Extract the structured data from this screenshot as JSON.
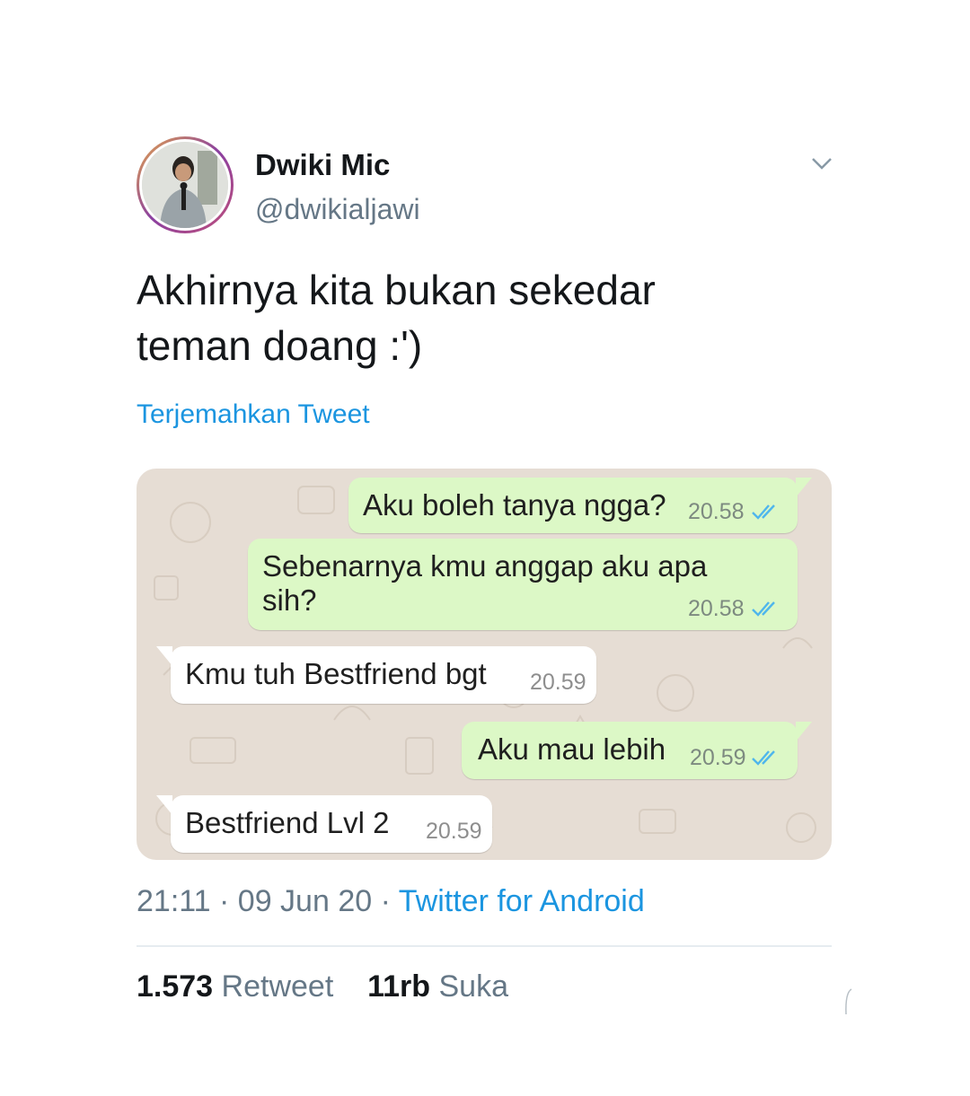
{
  "tweet": {
    "author_name": "Dwiki Mic",
    "author_handle": "@dwikialjawi",
    "text_line1": "Akhirnya kita bukan sekedar",
    "text_line2": "teman doang :')",
    "translate_label": "Terjemahkan Tweet",
    "time": "21:11",
    "date": "09 Jun 20",
    "source": "Twitter for Android",
    "retweet_count": "1.573",
    "retweet_label": "Retweet",
    "like_count": "11rb",
    "like_label": "Suka",
    "menu_icon": "chevron-down-icon"
  },
  "chat": {
    "messages": [
      {
        "direction": "out",
        "line1": "Aku boleh tanya ngga?",
        "time": "20.58",
        "status_icon": "double-check-icon"
      },
      {
        "direction": "out",
        "line1": "Sebenarnya kmu anggap aku apa",
        "line2": "sih?",
        "time": "20.58",
        "status_icon": "double-check-icon"
      },
      {
        "direction": "in",
        "line1": "Kmu tuh Bestfriend bgt",
        "time": "20.59"
      },
      {
        "direction": "out",
        "line1": "Aku mau lebih",
        "time": "20.59",
        "status_icon": "double-check-icon"
      },
      {
        "direction": "in",
        "line1": "Bestfriend Lvl 2",
        "time": "20.59"
      }
    ]
  },
  "colors": {
    "text_primary": "#14171a",
    "text_secondary": "#657786",
    "link": "#1b95e0",
    "chat_background": "#e6ddd4",
    "bubble_outgoing": "#dcf8c6",
    "bubble_incoming": "#ffffff",
    "read_ticks": "#4fb6ec"
  }
}
